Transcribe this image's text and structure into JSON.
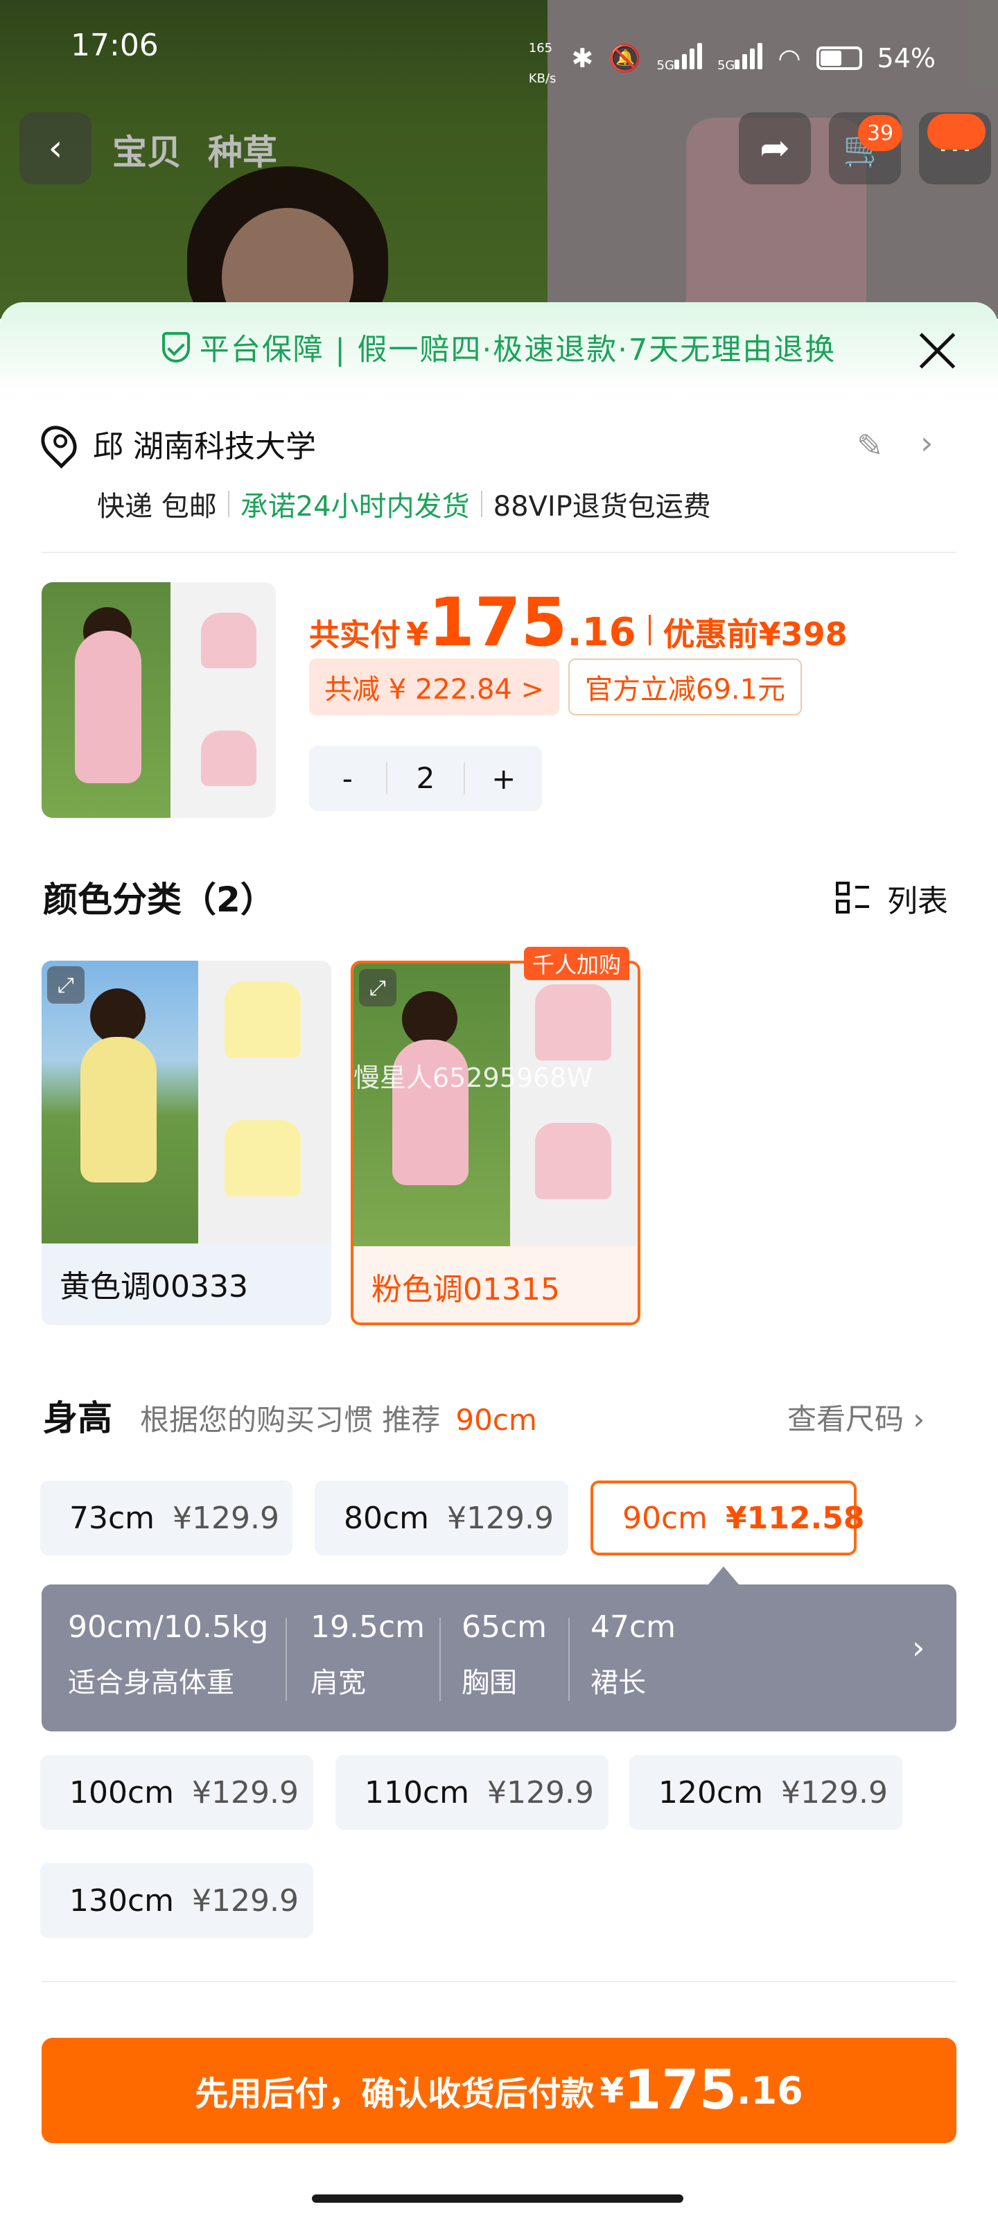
{
  "status_bar": {
    "time": "17:06",
    "speed_value": "165",
    "speed_unit": "KB/s",
    "net1": "5G",
    "net2": "5G",
    "battery": "54%"
  },
  "nav": {
    "tab_item": "宝贝",
    "tab_grass": "种草",
    "cart_count": "39"
  },
  "guarantee": {
    "text": "平台保障 | 假一赔四·极速退款·7天无理由退换"
  },
  "address": {
    "name": "邱 湖南科技大学",
    "ship_method": "快递 包邮",
    "promise": "承诺24小时内发货",
    "vip": "88VIP退货包运费"
  },
  "product": {
    "pay_label": "共实付",
    "currency": "¥",
    "price_int": "175",
    "price_dec": ".16",
    "before_label": "优惠前",
    "before_price": "¥398",
    "discount_total": "共减 ¥ 222.84 >",
    "official_off": "官方立减69.1元",
    "quantity": "2",
    "minus": "-",
    "plus": "+"
  },
  "color_section": {
    "title": "颜色分类（2）",
    "view_toggle": "列表",
    "hot_badge": "千人加购",
    "watermark": "慢星人65295968W",
    "options": [
      {
        "label": "黄色调00333",
        "selected": false
      },
      {
        "label": "粉色调01315",
        "selected": true
      }
    ]
  },
  "height_section": {
    "title": "身高",
    "recommend_text": "根据您的购买习惯 推荐",
    "recommend_value": "90cm",
    "size_chart": "查看尺码",
    "options": [
      {
        "size": "73cm",
        "price": "¥129.9"
      },
      {
        "size": "80cm",
        "price": "¥129.9"
      },
      {
        "size": "90cm",
        "price": "¥112.58",
        "selected": true
      },
      {
        "size": "100cm",
        "price": "¥129.9"
      },
      {
        "size": "110cm",
        "price": "¥129.9"
      },
      {
        "size": "120cm",
        "price": "¥129.9"
      },
      {
        "size": "130cm",
        "price": "¥129.9"
      }
    ],
    "specs": [
      {
        "value": "90cm/10.5kg",
        "key": "适合身高体重"
      },
      {
        "value": "19.5cm",
        "key": "肩宽"
      },
      {
        "value": "65cm",
        "key": "胸围"
      },
      {
        "value": "47cm",
        "key": "裙长"
      }
    ]
  },
  "cta": {
    "text": "先用后付，确认收货后付款",
    "currency": "¥",
    "price_int": "175",
    "price_dec": ".16"
  },
  "colors": {
    "accent": "#ff5000",
    "green": "#1aa35a",
    "spec_bg": "#878b9c"
  }
}
